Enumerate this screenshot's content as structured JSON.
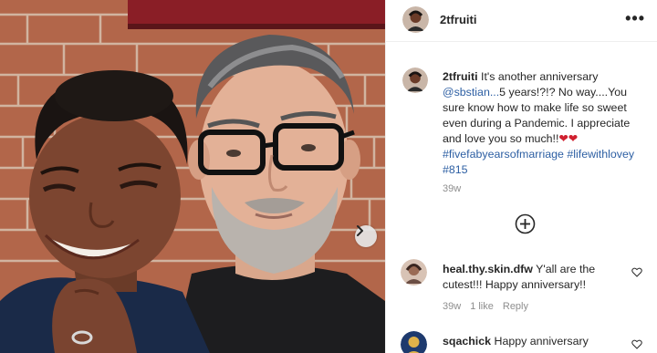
{
  "post": {
    "username": "2tfruiti",
    "more_label": "•••",
    "caption": {
      "username": "2tfruiti",
      "text_before_mention": "It's another anniversary",
      "mention": "@sbstian...",
      "text_after_mention": "5 years!?!? No way....You sure know how to make life so sweet even during a Pandemic. I appreciate and love you so much!!",
      "emoji": "❤❤",
      "hashtags": "#fivefabyearsofmarriage #lifewithlovey #815"
    },
    "time": "39w"
  },
  "comments": [
    {
      "username": "heal.thy.skin.dfw",
      "text": "Y'all are the cutest!!! Happy anniversary!!",
      "time": "39w",
      "likes": "1 like",
      "reply_label": "Reply"
    },
    {
      "username": "sqachick",
      "text": "Happy anniversary"
    }
  ],
  "icons": {
    "next": "chevron-right-icon",
    "add": "plus-circle-icon",
    "like": "heart-outline-icon",
    "more": "more-dots-icon"
  },
  "colors": {
    "link_blue": "#2d5fa3",
    "muted_text": "#8e8e8e",
    "heart_red": "#d0202f"
  }
}
